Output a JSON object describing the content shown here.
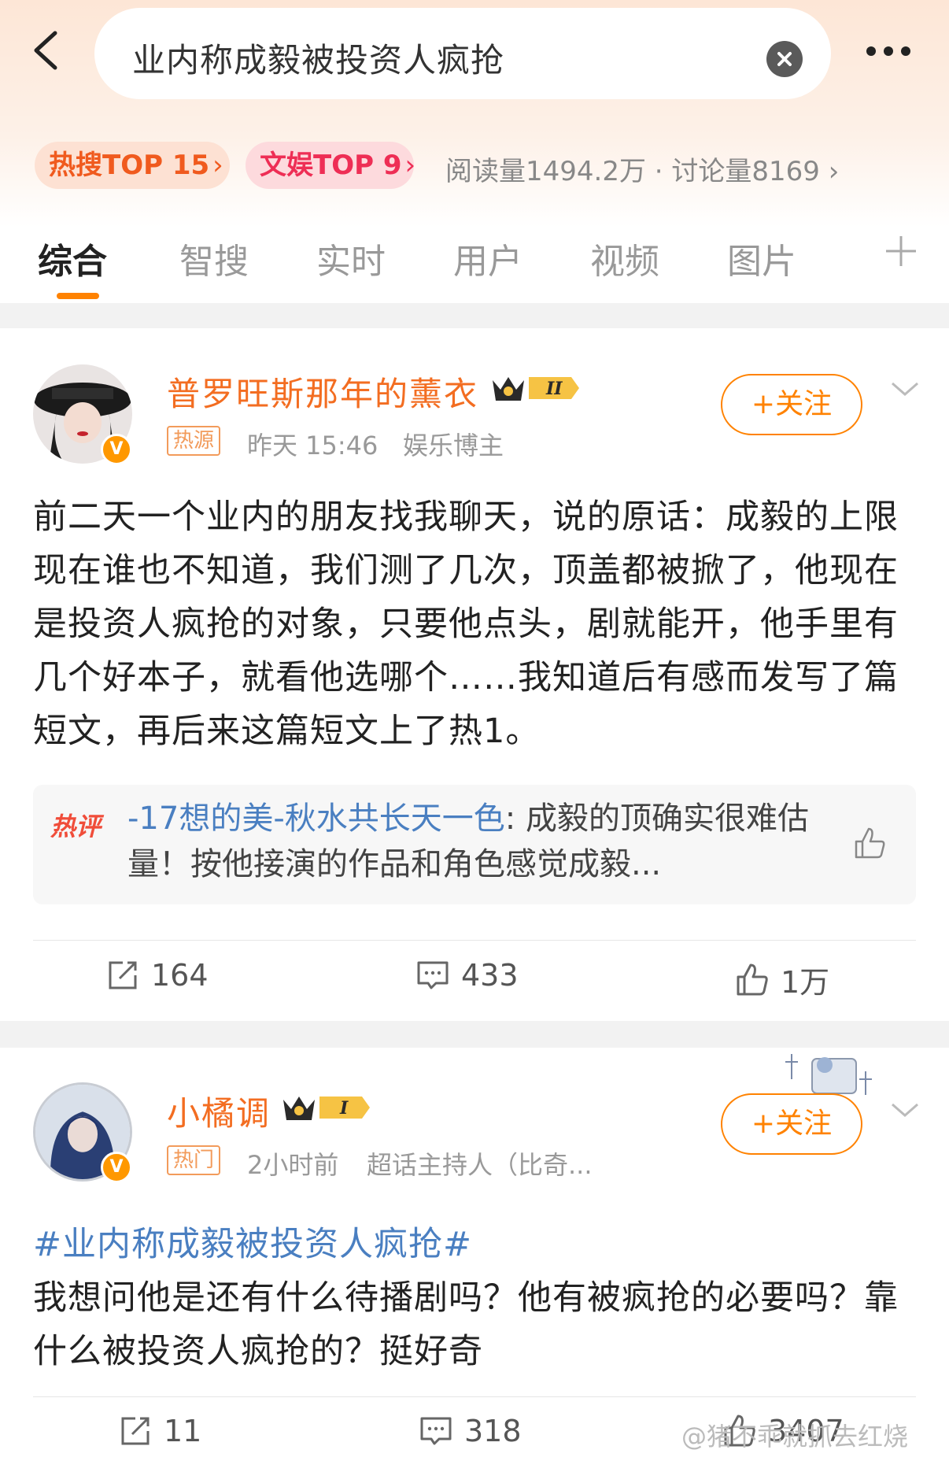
{
  "search": {
    "query": "业内称成毅被投资人疯抢"
  },
  "hot_tags": {
    "hot_search": "热搜TOP 15",
    "entertainment": "文娱TOP 9",
    "stats": "阅读量1494.2万 · 讨论量8169"
  },
  "tabs": [
    "综合",
    "智搜",
    "实时",
    "用户",
    "视频",
    "图片"
  ],
  "posts": [
    {
      "username": "普罗旺斯那年的薰衣",
      "badge": "热源",
      "time": "昨天 15:46",
      "role": "娱乐博主",
      "follow_label": "+关注",
      "text": "前二天一个业内的朋友找我聊天，说的原话：成毅的上限现在谁也不知道，我们测了几次，顶盖都被掀了，他现在是投资人疯抢的对象，只要他点头，剧就能开，他手里有几个好本子，就看他选哪个……我知道后有感而发写了篇短文，再后来这篇短文上了热1。",
      "hot_comment": {
        "label": "热评",
        "user": "-17想的美-秋水共长天一色",
        "text": ": 成毅的顶确实很难估量！按他接演的作品和角色感觉成毅..."
      },
      "reposts": "164",
      "comments": "433",
      "likes": "1万"
    },
    {
      "username": "小橘调",
      "badge": "热门",
      "time": "2小时前",
      "role": "超话主持人（比奇...",
      "follow_label": "+关注",
      "topic": "#业内称成毅被投资人疯抢#",
      "text": "我想问他是还有什么待播剧吗？他有被疯抢的必要吗？靠什么被投资人疯抢的？挺好奇",
      "reposts": "11",
      "comments": "318",
      "likes": "3407"
    }
  ],
  "watermark": "@猪不乖就抓去红烧",
  "colors": {
    "accent": "#ff8200",
    "username": "#f36d21",
    "link": "#4a7fc1"
  }
}
